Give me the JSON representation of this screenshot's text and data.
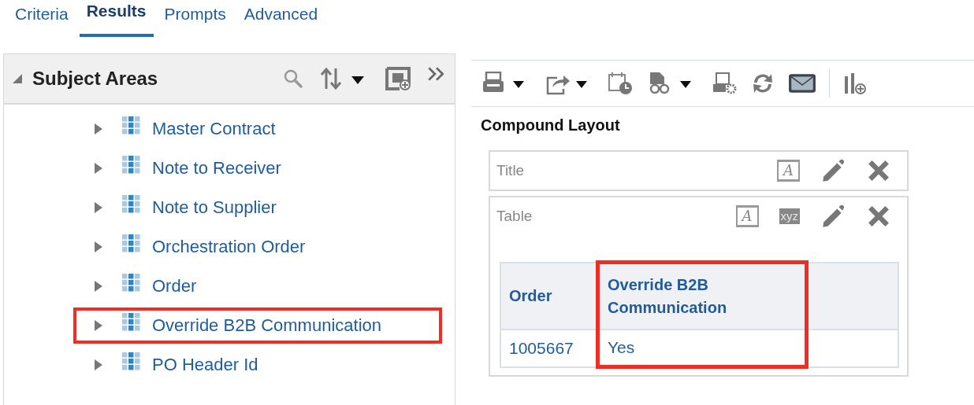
{
  "tabs": [
    {
      "label": "Criteria",
      "selected": false
    },
    {
      "label": "Results",
      "selected": true
    },
    {
      "label": "Prompts",
      "selected": false
    },
    {
      "label": "Advanced",
      "selected": false
    }
  ],
  "subject_areas": {
    "title": "Subject Areas",
    "expanded": true,
    "items": [
      {
        "label": "Master Contract",
        "highlighted": false
      },
      {
        "label": "Note to Receiver",
        "highlighted": false
      },
      {
        "label": "Note to Supplier",
        "highlighted": false
      },
      {
        "label": "Orchestration Order",
        "highlighted": false
      },
      {
        "label": "Order",
        "highlighted": false
      },
      {
        "label": "Override B2B Communication",
        "highlighted": true
      },
      {
        "label": "PO Header Id",
        "highlighted": false
      }
    ]
  },
  "layout": {
    "title": "Compound Layout",
    "views": [
      {
        "kind": "title",
        "label": "Title",
        "icons": [
          "A"
        ]
      },
      {
        "kind": "table",
        "label": "Table",
        "icons": [
          "A",
          "xyz"
        ],
        "columns": [
          {
            "label": "Order",
            "highlighted": false
          },
          {
            "label": "Override B2B Communication",
            "highlighted": true
          }
        ],
        "rows": [
          [
            "1005667",
            "Yes"
          ]
        ]
      }
    ]
  }
}
